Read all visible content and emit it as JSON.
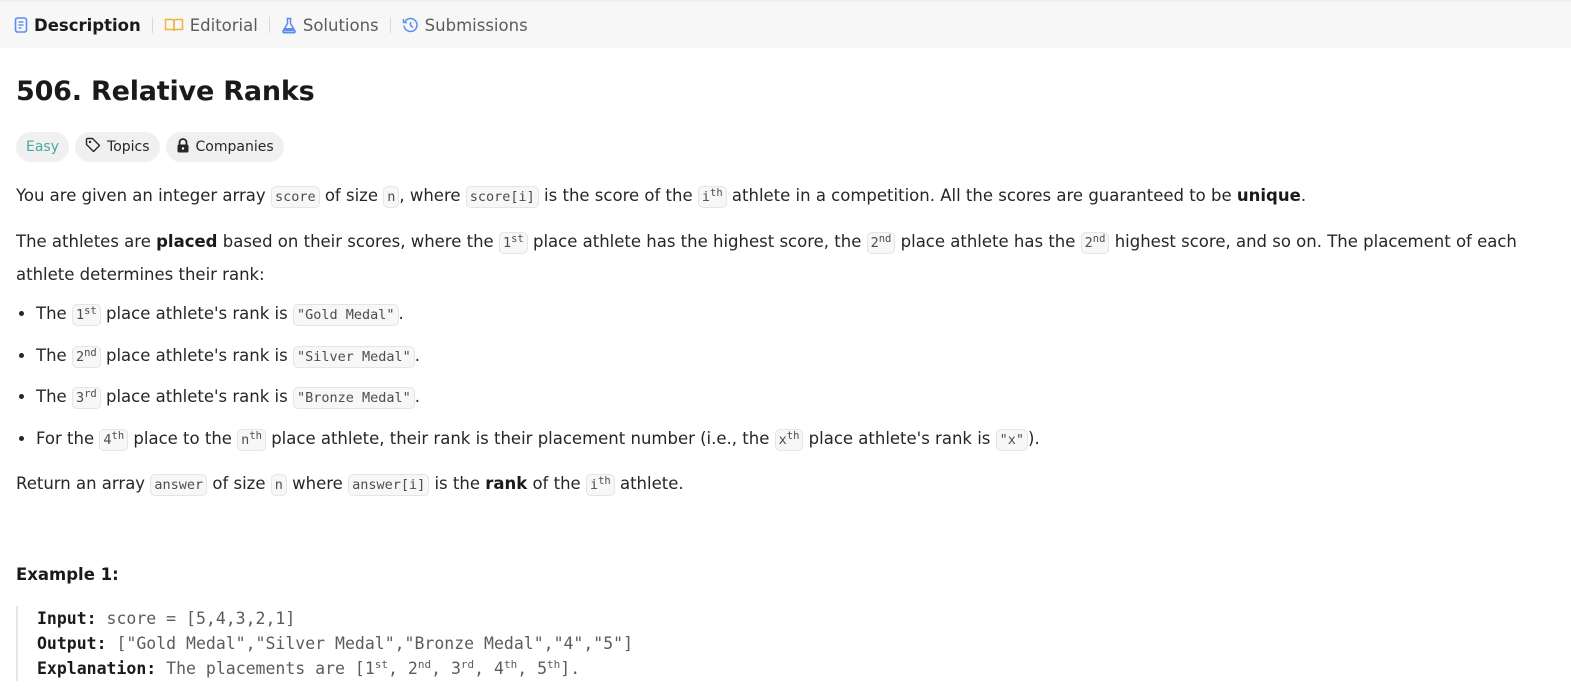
{
  "tabs": {
    "description": "Description",
    "editorial": "Editorial",
    "solutions": "Solutions",
    "submissions": "Submissions"
  },
  "problem": {
    "title": "506. Relative Ranks",
    "difficulty": "Easy",
    "topics": "Topics",
    "companies": "Companies"
  },
  "colors": {
    "easy": "#4aa8a4",
    "editorial_icon": "#f2b23a",
    "solutions_icon": "#5b8def",
    "submissions_icon": "#5b8def"
  },
  "icons": {
    "description": "document-icon",
    "editorial": "book-icon",
    "solutions": "flask-icon",
    "submissions": "history-icon",
    "topics": "tag-icon",
    "companies": "lock-icon"
  },
  "p1": {
    "t1": "You are given an integer array ",
    "c1": "score",
    "t2": " of size ",
    "c2": "n",
    "t3": ", where ",
    "c3": "score[i]",
    "t4": " is the score of the ",
    "c4": "i",
    "c4sup": "th",
    "t5": " athlete in a competition. All the scores are guaranteed to be ",
    "b1": "unique",
    "t6": "."
  },
  "p2": {
    "t1": "The athletes are ",
    "b1": "placed",
    "t2": " based on their scores, where the ",
    "c1": "1",
    "c1sup": "st",
    "t3": " place athlete has the highest score, the ",
    "c2": "2",
    "c2sup": "nd",
    "t4": " place athlete has the ",
    "c3": "2",
    "c3sup": "nd",
    "t5": " highest score, and so on. The placement of each athlete determines their rank:"
  },
  "bullets": [
    {
      "t1": "The ",
      "c1": "1",
      "c1sup": "st",
      "t2": " place athlete's rank is ",
      "c2": "\"Gold Medal\"",
      "t3": "."
    },
    {
      "t1": "The ",
      "c1": "2",
      "c1sup": "nd",
      "t2": " place athlete's rank is ",
      "c2": "\"Silver Medal\"",
      "t3": "."
    },
    {
      "t1": "The ",
      "c1": "3",
      "c1sup": "rd",
      "t2": " place athlete's rank is ",
      "c2": "\"Bronze Medal\"",
      "t3": "."
    },
    {
      "t1": "For the ",
      "c1": "4",
      "c1sup": "th",
      "t2": " place to the ",
      "c2": "n",
      "c2sup": "th",
      "t3": " place athlete, their rank is their placement number (i.e., the ",
      "c3": "x",
      "c3sup": "th",
      "t4": " place athlete's rank is ",
      "c4": "\"x\"",
      "t5": ")."
    }
  ],
  "p3": {
    "t1": "Return an array ",
    "c1": "answer",
    "t2": " of size ",
    "c2": "n",
    "t3": " where ",
    "c3": "answer[i]",
    "t4": " is the ",
    "b1": "rank",
    "t5": " of the ",
    "c4": "i",
    "c4sup": "th",
    "t6": " athlete."
  },
  "example1": {
    "title": "Example 1:",
    "input_label": "Input:",
    "input_value": " score = [5,4,3,2,1]",
    "output_label": "Output:",
    "output_value": " [\"Gold Medal\",\"Silver Medal\",\"Bronze Medal\",\"4\",\"5\"]",
    "explanation_label": "Explanation:",
    "e_t1": " The placements are [1",
    "e_s1": "st",
    "e_t2": ", 2",
    "e_s2": "nd",
    "e_t3": ", 3",
    "e_s3": "rd",
    "e_t4": ", 4",
    "e_s4": "th",
    "e_t5": ", 5",
    "e_s5": "th",
    "e_t6": "]."
  }
}
